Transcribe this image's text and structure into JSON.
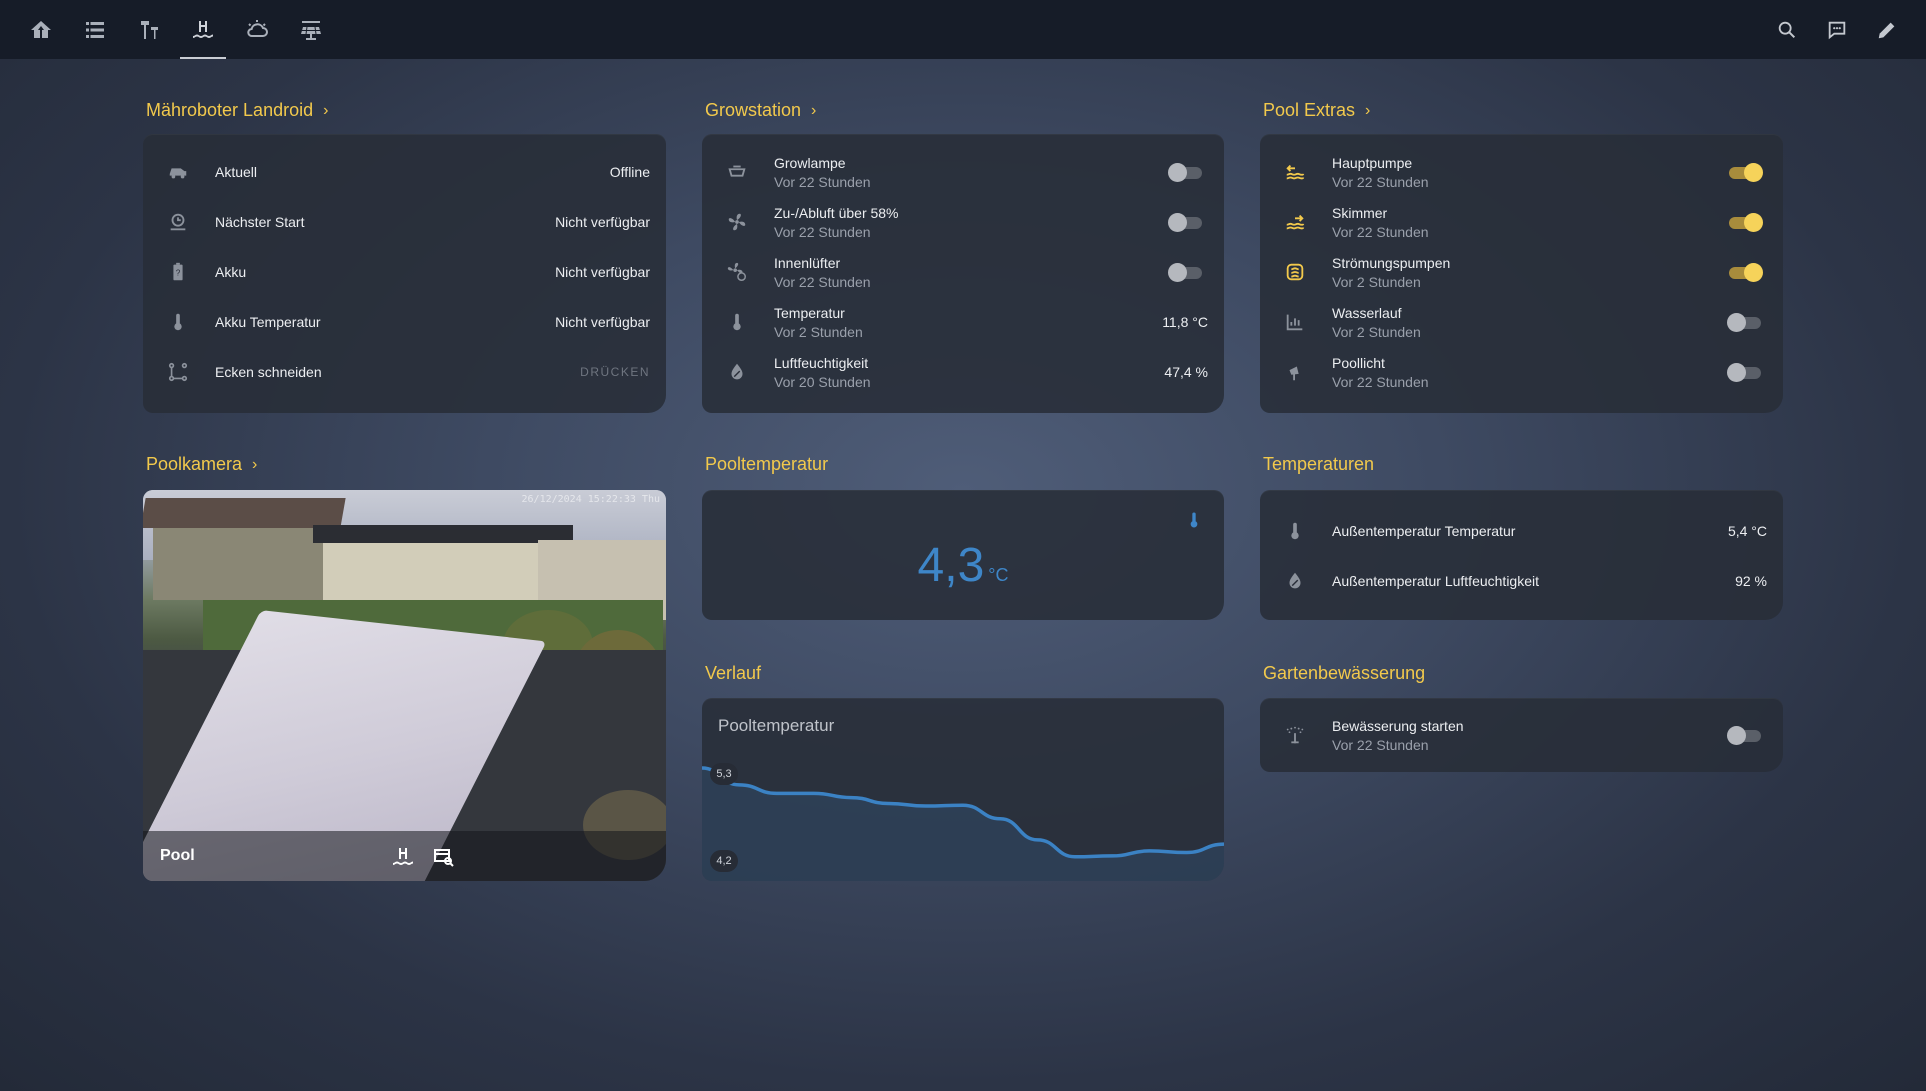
{
  "nav": {
    "items": [
      {
        "name": "nav-home",
        "icon": "home-tree-icon"
      },
      {
        "name": "nav-list",
        "icon": "list-icon"
      },
      {
        "name": "nav-garden",
        "icon": "garden-lamp-icon"
      },
      {
        "name": "nav-pool",
        "icon": "pool-icon",
        "active": true
      },
      {
        "name": "nav-weather",
        "icon": "weather-partly-cloudy-icon"
      },
      {
        "name": "nav-solar",
        "icon": "solar-panel-icon"
      }
    ],
    "actions": [
      "search-icon",
      "chat-icon",
      "pencil-icon"
    ]
  },
  "landroid": {
    "title": "Mähroboter Landroid",
    "rows": [
      {
        "name": "Aktuell",
        "value": "Offline"
      },
      {
        "name": "Nächster Start",
        "value": "Nicht verfügbar"
      },
      {
        "name": "Akku",
        "value": "Nicht verfügbar"
      },
      {
        "name": "Akku Temperatur",
        "value": "Nicht verfügbar"
      },
      {
        "name": "Ecken schneiden",
        "value": "DRÜCKEN"
      }
    ]
  },
  "growstation": {
    "title": "Growstation",
    "rows": [
      {
        "name": "Growlampe",
        "sub": "Vor 22 Stunden",
        "state": "off"
      },
      {
        "name": "Zu-/Abluft über 58%",
        "sub": "Vor 22 Stunden",
        "state": "off"
      },
      {
        "name": "Innenlüfter",
        "sub": "Vor 22 Stunden",
        "state": "off"
      },
      {
        "name": "Temperatur",
        "sub": "Vor 2 Stunden",
        "value": "11,8 °C"
      },
      {
        "name": "Luftfeuchtigkeit",
        "sub": "Vor 20 Stunden",
        "value": "47,4 %"
      }
    ]
  },
  "pool_extras": {
    "title": "Pool Extras",
    "rows": [
      {
        "name": "Hauptpumpe",
        "sub": "Vor 22 Stunden",
        "state": "on"
      },
      {
        "name": "Skimmer",
        "sub": "Vor 22 Stunden",
        "state": "on"
      },
      {
        "name": "Strömungspumpen",
        "sub": "Vor 2 Stunden",
        "state": "on"
      },
      {
        "name": "Wasserlauf",
        "sub": "Vor 2 Stunden",
        "state": "off"
      },
      {
        "name": "Poollicht",
        "sub": "Vor 22 Stunden",
        "state": "off"
      }
    ]
  },
  "poolkamera": {
    "title": "Poolkamera",
    "label": "Pool",
    "timestamp": "26/12/2024 15:22:33 Thu"
  },
  "pooltemperatur": {
    "title": "Pooltemperatur",
    "value": "4,3",
    "unit": "°C"
  },
  "temperaturen": {
    "title": "Temperaturen",
    "rows": [
      {
        "name": "Außentemperatur Temperatur",
        "value": "5,4 °C"
      },
      {
        "name": "Außentemperatur Luftfeuchtigkeit",
        "value": "92 %"
      }
    ]
  },
  "verlauf": {
    "title": "Verlauf",
    "graph_title": "Pooltemperatur",
    "max_label": "5,3",
    "min_label": "4,2"
  },
  "chart_data": {
    "type": "area",
    "title": "Pooltemperatur",
    "ylim": [
      4.2,
      5.3
    ],
    "y": [
      5.3,
      5.1,
      5.0,
      5.0,
      4.95,
      4.88,
      4.85,
      4.86,
      4.7,
      4.45,
      4.25,
      4.26,
      4.32,
      4.3,
      4.4
    ],
    "color": "#3b82c4"
  },
  "gartenbewaesserung": {
    "title": "Gartenbewässerung",
    "rows": [
      {
        "name": "Bewässerung starten",
        "sub": "Vor 22 Stunden",
        "state": "off"
      }
    ]
  },
  "colors": {
    "accent": "#f2c94c",
    "blue": "#3e86c8",
    "toggle_on": "#f6d35a"
  }
}
